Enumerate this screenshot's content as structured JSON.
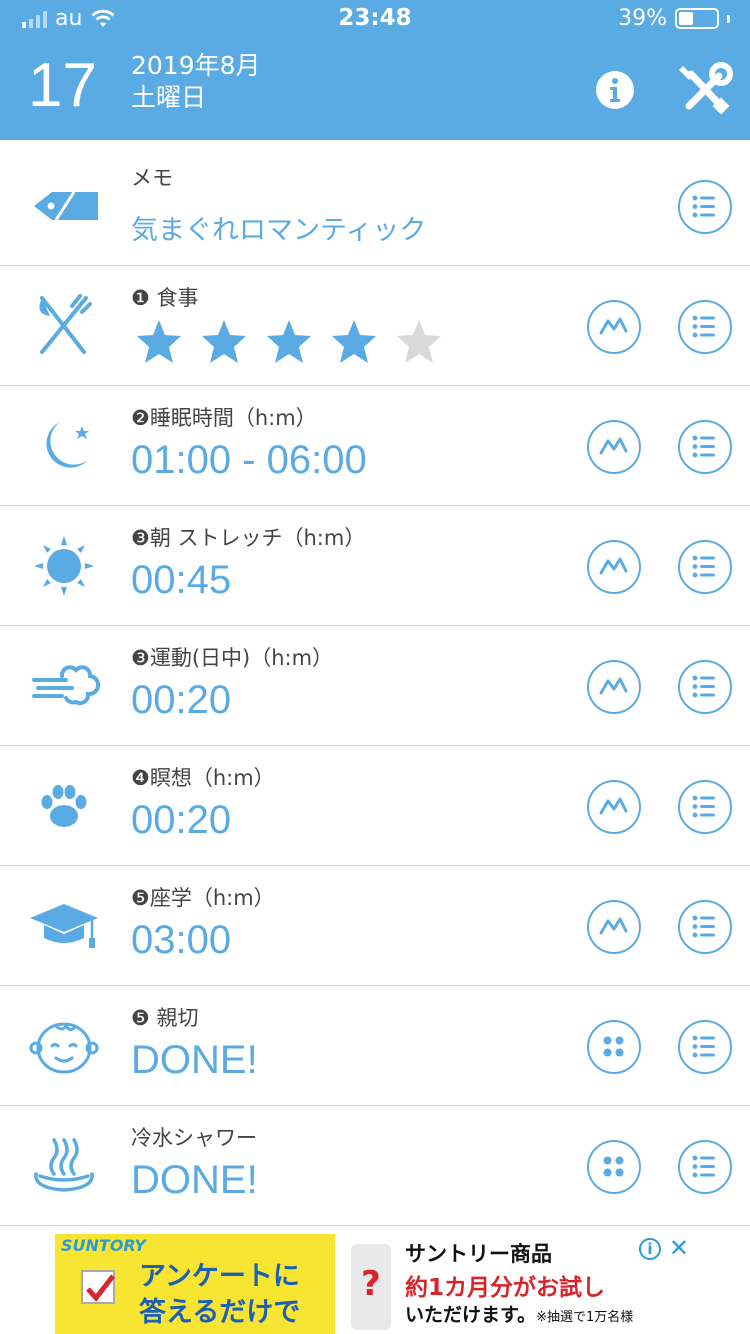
{
  "status_bar": {
    "carrier": "au",
    "time": "23:48",
    "battery": "39%",
    "battery_level": 0.39
  },
  "header": {
    "day": "17",
    "year_month": "2019年8月",
    "weekday": "土曜日",
    "info_icon": "info-icon",
    "settings_icon": "tools-icon"
  },
  "rows": [
    {
      "label": "メモ",
      "value": "気まぐれロマンティック",
      "icon": "tag-icon"
    },
    {
      "label": "❶ 食事",
      "rating": 4,
      "rating_max": 5,
      "icon": "fork-knife-icon"
    },
    {
      "label": "❷睡眠時間（h:m）",
      "value": "01:00 - 06:00",
      "icon": "moon-icon"
    },
    {
      "label": "❸朝 ストレッチ（h:m）",
      "value": "00:45",
      "icon": "sun-icon"
    },
    {
      "label": "❸運動(日中)（h:m）",
      "value": "00:20",
      "icon": "wind-icon"
    },
    {
      "label": "❹瞑想（h:m）",
      "value": "00:20",
      "icon": "paw-icon"
    },
    {
      "label": "❺座学（h:m）",
      "value": "03:00",
      "icon": "graduation-cap-icon"
    },
    {
      "label": "❺ 親切",
      "value": "DONE!",
      "icon": "baby-face-icon"
    },
    {
      "label": "冷水シャワー",
      "value": "DONE!",
      "icon": "hot-spring-icon"
    }
  ],
  "colors": {
    "accent": "#5aabe3",
    "star_on": "#5aabe3",
    "star_off": "#d9d9d9"
  },
  "ad": {
    "brand": "SUNTORY",
    "headline_1": "アンケートに",
    "headline_2": "答えるだけで",
    "right_1": "サントリー商品",
    "right_2": "約1カ月分がお試し",
    "right_3": "いただけます。",
    "right_3_small": "※抽選で1万名様",
    "question_mark": "?"
  }
}
